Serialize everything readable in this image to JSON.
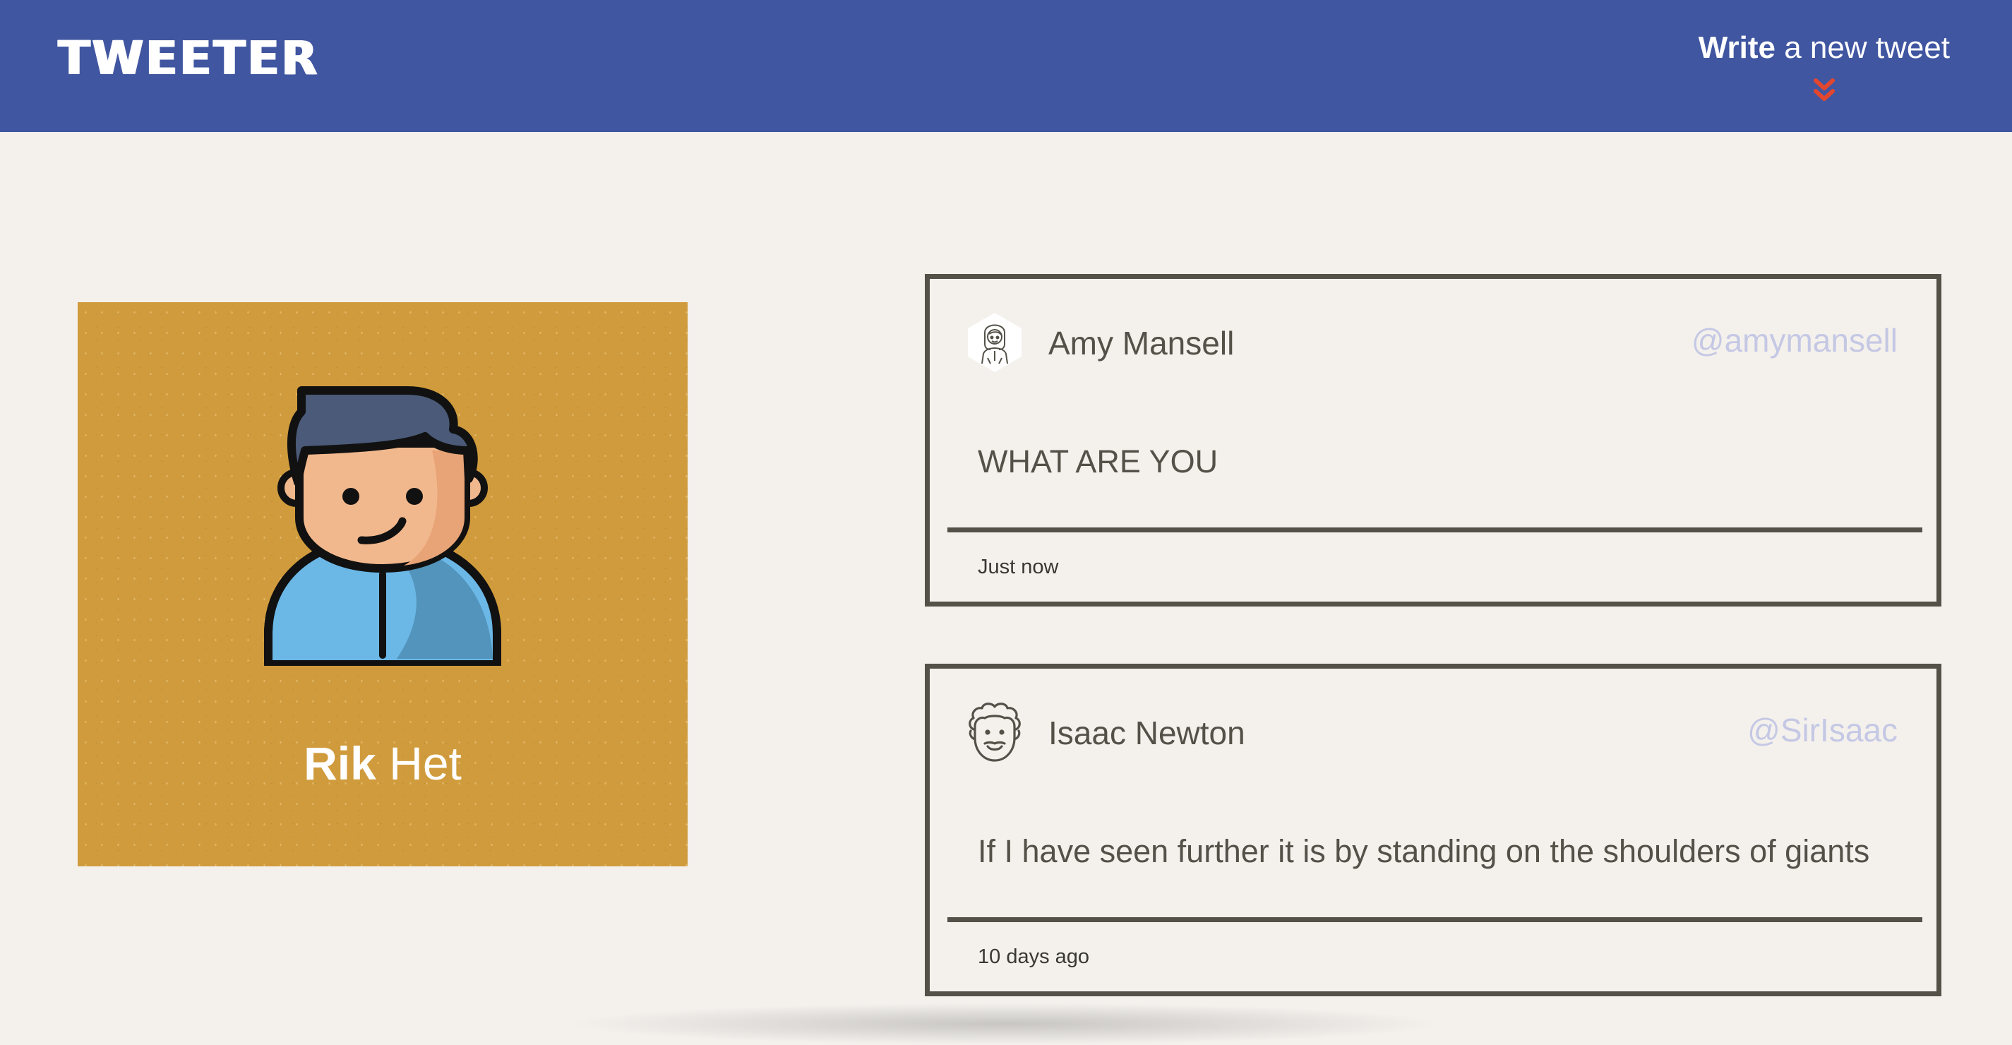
{
  "header": {
    "logo": "TWEETER",
    "compose_bold": "Write",
    "compose_rest": " a new tweet"
  },
  "colors": {
    "nav": "#4056a1",
    "background": "#f4f1ed",
    "profile_card": "#d09b3c",
    "arrow": "#e2462f",
    "text": "#545149",
    "handle": "#c5c8e4"
  },
  "profile": {
    "first_name": "Rik",
    "last_name": "Het"
  },
  "tweets": [
    {
      "name": "Amy Mansell",
      "handle": "@amymansell",
      "text": "WHAT ARE YOU",
      "time": "Just now",
      "avatar_icon": "woman-avatar-icon"
    },
    {
      "name": "Isaac Newton",
      "handle": "@SirIsaac",
      "text": "If I have seen further it is by standing on the shoulders of giants",
      "time": "10 days ago",
      "avatar_icon": "man-curly-hair-avatar-icon"
    }
  ]
}
